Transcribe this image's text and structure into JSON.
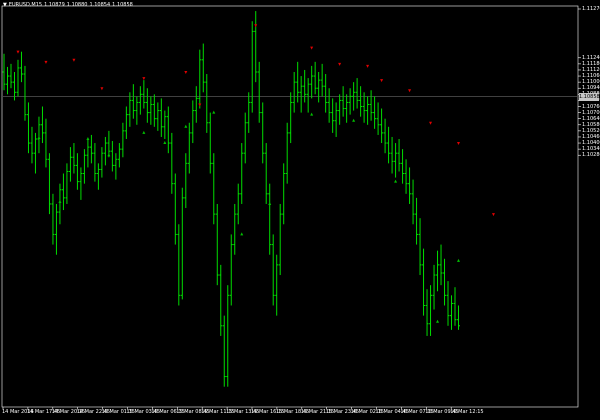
{
  "window": {
    "symbol": "EURUSD,M15",
    "ohlc": [
      "1.10879",
      "1.10880",
      "1.10854",
      "1.10858"
    ],
    "dropdown_icon": "triangle-down-icon"
  },
  "price_axis": {
    "labels": [
      "1.11270",
      "1.11240",
      "1.11180",
      "1.11120",
      "1.11060",
      "1.11000",
      "1.10940",
      "1.10880",
      "1.10820",
      "1.10760",
      "1.10700",
      "1.10640",
      "1.10580",
      "1.10520",
      "1.10460",
      "1.10400",
      "1.10340",
      "1.10280"
    ]
  },
  "current_price": "1.10858",
  "time_axis": {
    "labels": [
      "14 Mar 2016",
      "14 Mar 17:45",
      "14 Mar 20:15",
      "14 Mar 22:45",
      "15 Mar 01:15",
      "15 Mar 03:45",
      "15 Mar 06:15",
      "15 Mar 08:45",
      "15 Mar 11:15",
      "15 Mar 13:45",
      "15 Mar 16:15",
      "15 Mar 18:45",
      "15 Mar 21:15",
      "15 Mar 23:45",
      "16 Mar 02:15",
      "16 Mar 04:45",
      "16 Mar 07:15",
      "16 Mar 09:45",
      "16 Mar 12:15"
    ]
  },
  "colors": {
    "background": "#000000",
    "bar": "#00dd00",
    "grid_line": "#4a4a4a",
    "axis": "#ffffff",
    "arrow_up": "#00c000",
    "arrow_down": "#e00000",
    "price_tag_bg": "#c8c8c8"
  },
  "chart_data": {
    "type": "ohlc-bars",
    "series": [
      {
        "values": [
          [
            1.111,
            1.1128,
            1.1092,
            1.1098
          ],
          [
            1.1098,
            1.1115,
            1.1088,
            1.1106
          ],
          [
            1.1106,
            1.1118,
            1.1094,
            1.11
          ],
          [
            1.11,
            1.111,
            1.1082,
            1.109
          ],
          [
            1.109,
            1.1122,
            1.1086,
            1.1114
          ],
          [
            1.1114,
            1.113,
            1.11,
            1.1108
          ],
          [
            1.1108,
            1.1116,
            1.1062,
            1.1068
          ],
          [
            1.1068,
            1.108,
            1.103,
            1.104
          ],
          [
            1.104,
            1.1056,
            1.102,
            1.103
          ],
          [
            1.103,
            1.105,
            1.101,
            1.1044
          ],
          [
            1.1044,
            1.1066,
            1.103,
            1.1058
          ],
          [
            1.1058,
            1.1076,
            1.104,
            1.105
          ],
          [
            1.105,
            1.1064,
            1.1016,
            1.1024
          ],
          [
            1.1024,
            1.103,
            1.097,
            1.098
          ],
          [
            1.098,
            1.099,
            1.094,
            1.095
          ],
          [
            1.095,
            1.098,
            1.093,
            1.0972
          ],
          [
            1.0972,
            1.1,
            1.096,
            1.0994
          ],
          [
            1.0994,
            1.101,
            1.0974,
            1.0986
          ],
          [
            1.0986,
            1.102,
            1.098,
            1.1012
          ],
          [
            1.1012,
            1.1036,
            1.1002,
            1.1026
          ],
          [
            1.1026,
            1.104,
            1.101,
            1.1018
          ],
          [
            1.1018,
            1.103,
            1.0994,
            1.1002
          ],
          [
            1.1002,
            1.1016,
            1.0984,
            1.101
          ],
          [
            1.101,
            1.1034,
            1.1,
            1.1028
          ],
          [
            1.1028,
            1.1044,
            1.1016,
            1.1036
          ],
          [
            1.1036,
            1.1048,
            1.102,
            1.103
          ],
          [
            1.103,
            1.104,
            1.1002,
            1.101
          ],
          [
            1.101,
            1.102,
            1.0994,
            1.1014
          ],
          [
            1.1014,
            1.1036,
            1.1006,
            1.103
          ],
          [
            1.103,
            1.1046,
            1.1018,
            1.104
          ],
          [
            1.104,
            1.1052,
            1.1026,
            1.1032
          ],
          [
            1.1032,
            1.1042,
            1.1012,
            1.1018
          ],
          [
            1.1018,
            1.103,
            1.1004,
            1.1024
          ],
          [
            1.1024,
            1.104,
            1.1016,
            1.1034
          ],
          [
            1.1034,
            1.106,
            1.1026,
            1.1052
          ],
          [
            1.1052,
            1.1076,
            1.1044,
            1.1068
          ],
          [
            1.1068,
            1.109,
            1.1056,
            1.1082
          ],
          [
            1.1082,
            1.1098,
            1.1064,
            1.1072
          ],
          [
            1.1072,
            1.1086,
            1.1058,
            1.108
          ],
          [
            1.108,
            1.1096,
            1.1068,
            1.1088
          ],
          [
            1.1088,
            1.1102,
            1.1074,
            1.108
          ],
          [
            1.108,
            1.1094,
            1.106,
            1.107
          ],
          [
            1.107,
            1.1086,
            1.1058,
            1.1078
          ],
          [
            1.1078,
            1.1088,
            1.1056,
            1.1064
          ],
          [
            1.1064,
            1.108,
            1.1052,
            1.1072
          ],
          [
            1.1072,
            1.1084,
            1.1046,
            1.1056
          ],
          [
            1.1056,
            1.1072,
            1.1044,
            1.1066
          ],
          [
            1.1066,
            1.1076,
            1.103,
            1.104
          ],
          [
            1.104,
            1.105,
            1.099,
            1.1
          ],
          [
            1.1,
            1.101,
            1.094,
            1.095
          ],
          [
            1.095,
            1.096,
            1.088,
            1.089
          ],
          [
            1.089,
            1.0996,
            1.0886,
            1.0986
          ],
          [
            1.0986,
            1.103,
            1.0976,
            1.102
          ],
          [
            1.102,
            1.106,
            1.101,
            1.105
          ],
          [
            1.105,
            1.1082,
            1.104,
            1.1072
          ],
          [
            1.1072,
            1.1096,
            1.106,
            1.1084
          ],
          [
            1.1084,
            1.1132,
            1.1074,
            1.1122
          ],
          [
            1.1122,
            1.1138,
            1.109,
            1.11
          ],
          [
            1.11,
            1.1108,
            1.105,
            1.106
          ],
          [
            1.106,
            1.107,
            1.101,
            1.102
          ],
          [
            1.102,
            1.103,
            1.096,
            1.097
          ],
          [
            1.097,
            1.098,
            1.09,
            1.091
          ],
          [
            1.091,
            1.092,
            1.085,
            1.086
          ],
          [
            1.086,
            1.087,
            1.08,
            1.081
          ],
          [
            1.081,
            1.09,
            1.08,
            1.089
          ],
          [
            1.089,
            1.095,
            1.088,
            1.094
          ],
          [
            1.094,
            1.098,
            1.093,
            1.097
          ],
          [
            1.097,
            1.1,
            1.096,
            1.099
          ],
          [
            1.099,
            1.104,
            1.098,
            1.103
          ],
          [
            1.103,
            1.107,
            1.102,
            1.106
          ],
          [
            1.106,
            1.109,
            1.105,
            1.108
          ],
          [
            1.108,
            1.116,
            1.107,
            1.115
          ],
          [
            1.115,
            1.117,
            1.11,
            1.111
          ],
          [
            1.111,
            1.112,
            1.106,
            1.107
          ],
          [
            1.107,
            1.108,
            1.102,
            1.103
          ],
          [
            1.103,
            1.104,
            1.098,
            1.099
          ],
          [
            1.099,
            1.1,
            1.093,
            1.094
          ],
          [
            1.094,
            1.095,
            1.088,
            1.089
          ],
          [
            1.089,
            1.093,
            1.087,
            1.092
          ],
          [
            1.092,
            1.098,
            1.091,
            1.097
          ],
          [
            1.097,
            1.102,
            1.096,
            1.101
          ],
          [
            1.101,
            1.106,
            1.1,
            1.105
          ],
          [
            1.105,
            1.109,
            1.104,
            1.108
          ],
          [
            1.108,
            1.111,
            1.107,
            1.11
          ],
          [
            1.11,
            1.112,
            1.108,
            1.109
          ],
          [
            1.109,
            1.1106,
            1.107,
            1.1096
          ],
          [
            1.1096,
            1.1112,
            1.108,
            1.1088
          ],
          [
            1.1088,
            1.1104,
            1.107,
            1.1098
          ],
          [
            1.1098,
            1.1116,
            1.1084,
            1.1106
          ],
          [
            1.1106,
            1.112,
            1.1088,
            1.1094
          ],
          [
            1.1094,
            1.111,
            1.108,
            1.1102
          ],
          [
            1.1102,
            1.1118,
            1.1086,
            1.1096
          ],
          [
            1.1096,
            1.1108,
            1.107,
            1.108
          ],
          [
            1.108,
            1.1094,
            1.106,
            1.107
          ],
          [
            1.107,
            1.1084,
            1.105,
            1.1062
          ],
          [
            1.1062,
            1.108,
            1.1046,
            1.1072
          ],
          [
            1.1072,
            1.1088,
            1.1058,
            1.1082
          ],
          [
            1.1082,
            1.1096,
            1.1066,
            1.1074
          ],
          [
            1.1074,
            1.1088,
            1.106,
            1.108
          ],
          [
            1.108,
            1.1094,
            1.1068,
            1.1086
          ],
          [
            1.1086,
            1.11,
            1.1072,
            1.109
          ],
          [
            1.109,
            1.1104,
            1.1074,
            1.1082
          ],
          [
            1.1082,
            1.1096,
            1.1066,
            1.1076
          ],
          [
            1.1076,
            1.109,
            1.106,
            1.1072
          ],
          [
            1.1072,
            1.1086,
            1.1058,
            1.1078
          ],
          [
            1.1078,
            1.1092,
            1.1062,
            1.107
          ],
          [
            1.107,
            1.1086,
            1.1054,
            1.1064
          ],
          [
            1.1064,
            1.108,
            1.1048,
            1.1058
          ],
          [
            1.1058,
            1.1074,
            1.104,
            1.105
          ],
          [
            1.105,
            1.1064,
            1.103,
            1.104
          ],
          [
            1.104,
            1.1056,
            1.102,
            1.103
          ],
          [
            1.103,
            1.1046,
            1.101,
            1.1022
          ],
          [
            1.1022,
            1.104,
            1.1006,
            1.103
          ],
          [
            1.103,
            1.1044,
            1.1012,
            1.102
          ],
          [
            1.102,
            1.1034,
            1.1,
            1.101
          ],
          [
            1.101,
            1.1024,
            1.099,
            1.1
          ],
          [
            1.1,
            1.1016,
            1.098,
            1.099
          ],
          [
            1.099,
            1.1004,
            1.096,
            1.097
          ],
          [
            1.097,
            1.0986,
            1.094,
            1.095
          ],
          [
            1.095,
            1.0966,
            1.091,
            1.092
          ],
          [
            1.092,
            1.0936,
            1.087,
            1.088
          ],
          [
            1.088,
            1.0896,
            1.085,
            1.0862
          ],
          [
            1.0862,
            1.09,
            1.085,
            1.089
          ],
          [
            1.089,
            1.092,
            1.0876,
            1.091
          ],
          [
            1.091,
            1.0934,
            1.0894,
            1.092
          ],
          [
            1.092,
            1.094,
            1.09,
            1.0912
          ],
          [
            1.0912,
            1.0926,
            1.088,
            1.089
          ],
          [
            1.089,
            1.0904,
            1.086,
            1.087
          ],
          [
            1.087,
            1.089,
            1.0856,
            1.0882
          ],
          [
            1.0882,
            1.0898,
            1.086,
            1.0866
          ],
          [
            1.0866,
            1.088,
            1.0856,
            1.086
          ]
        ]
      }
    ],
    "x_labels": [
      "14 Mar 2016",
      "14 Mar 17:45",
      "14 Mar 20:15",
      "14 Mar 22:45",
      "15 Mar 01:15",
      "15 Mar 03:45",
      "15 Mar 06:15",
      "15 Mar 08:45",
      "15 Mar 11:15",
      "15 Mar 13:45",
      "15 Mar 16:15",
      "15 Mar 18:45",
      "15 Mar 21:15",
      "15 Mar 23:45",
      "16 Mar 02:15",
      "16 Mar 04:45",
      "16 Mar 07:15",
      "16 Mar 09:45",
      "16 Mar 12:15"
    ],
    "ylim": [
      1.078,
      1.1175
    ],
    "current_price": 1.10858,
    "up_arrows": [
      [
        10,
        1.1045
      ],
      [
        16,
        1.0982
      ],
      [
        24,
        1.1044
      ],
      [
        30,
        1.1028
      ],
      [
        40,
        1.105
      ],
      [
        46,
        1.104
      ],
      [
        52,
        1.1056
      ],
      [
        60,
        1.107
      ],
      [
        68,
        1.095
      ],
      [
        76,
        1.098
      ],
      [
        88,
        1.1068
      ],
      [
        100,
        1.1062
      ],
      [
        112,
        1.1002
      ],
      [
        124,
        1.0864
      ],
      [
        130,
        1.0924
      ]
    ],
    "down_arrows": [
      [
        4,
        1.113
      ],
      [
        12,
        1.112
      ],
      [
        20,
        1.1122
      ],
      [
        28,
        1.1094
      ],
      [
        40,
        1.1104
      ],
      [
        52,
        1.111
      ],
      [
        56,
        1.1078
      ],
      [
        72,
        1.1156
      ],
      [
        88,
        1.1134
      ],
      [
        96,
        1.1118
      ],
      [
        104,
        1.1116
      ],
      [
        108,
        1.1102
      ],
      [
        116,
        1.1092
      ],
      [
        122,
        1.106
      ],
      [
        130,
        1.104
      ],
      [
        140,
        1.097
      ]
    ],
    "grid": false
  }
}
